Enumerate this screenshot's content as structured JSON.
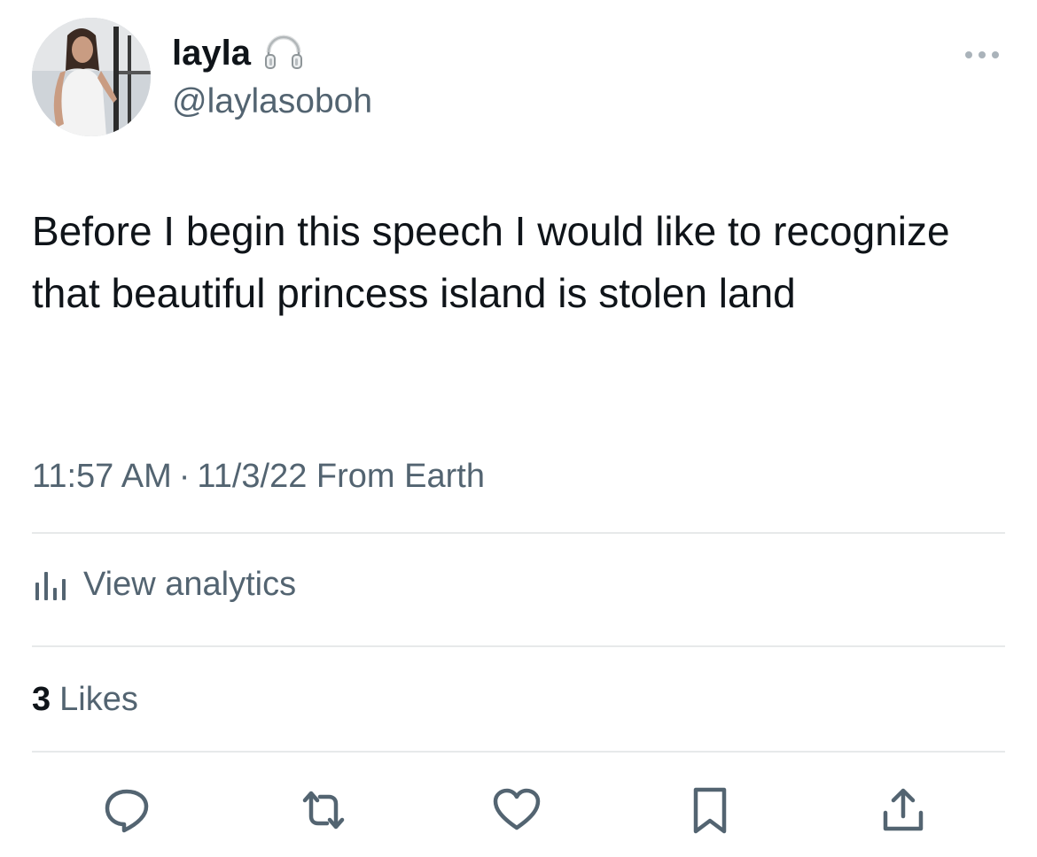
{
  "user": {
    "display_name": "layla",
    "handle": "@laylasoboh",
    "name_emoji": "headphones-icon"
  },
  "tweet": {
    "text": "Before I begin this speech I would like to recognize that beautiful princess island is stolen land"
  },
  "meta": {
    "time": "11:57 AM",
    "separator": "·",
    "date": "11/3/22",
    "source": "From Earth"
  },
  "analytics": {
    "label": "View analytics"
  },
  "likes": {
    "count": "3",
    "label": "Likes"
  },
  "actions": [
    "reply-icon",
    "retweet-icon",
    "like-icon",
    "bookmark-icon",
    "share-icon"
  ],
  "colors": {
    "text": "#0f1419",
    "secondary": "#536471",
    "divider": "#e7e9ea",
    "background": "#ffffff"
  }
}
